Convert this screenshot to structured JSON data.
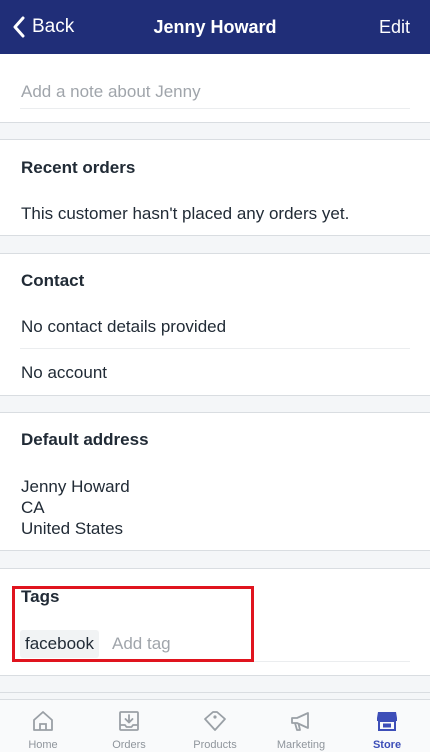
{
  "navbar": {
    "back_label": "Back",
    "title": "Jenny Howard",
    "edit_label": "Edit"
  },
  "note": {
    "placeholder": "Add a note about Jenny",
    "value": ""
  },
  "recent_orders": {
    "heading": "Recent orders",
    "text": "This customer hasn't placed any orders yet."
  },
  "contact": {
    "heading": "Contact",
    "details": "No contact details provided",
    "account": "No account"
  },
  "default_address": {
    "heading": "Default address",
    "lines": [
      "Jenny Howard",
      "CA",
      "United States"
    ]
  },
  "tags": {
    "heading": "Tags",
    "items": [
      "facebook"
    ],
    "input_placeholder": "Add tag"
  },
  "tabbar": {
    "items": [
      {
        "label": "Home",
        "icon": "home-icon"
      },
      {
        "label": "Orders",
        "icon": "orders-icon"
      },
      {
        "label": "Products",
        "icon": "tag-icon"
      },
      {
        "label": "Marketing",
        "icon": "megaphone-icon"
      },
      {
        "label": "Store",
        "icon": "store-icon"
      }
    ],
    "active": "Store"
  },
  "colors": {
    "navbar": "#202e78",
    "active_tab": "#3d4eb8",
    "highlight": "#e0141e"
  }
}
